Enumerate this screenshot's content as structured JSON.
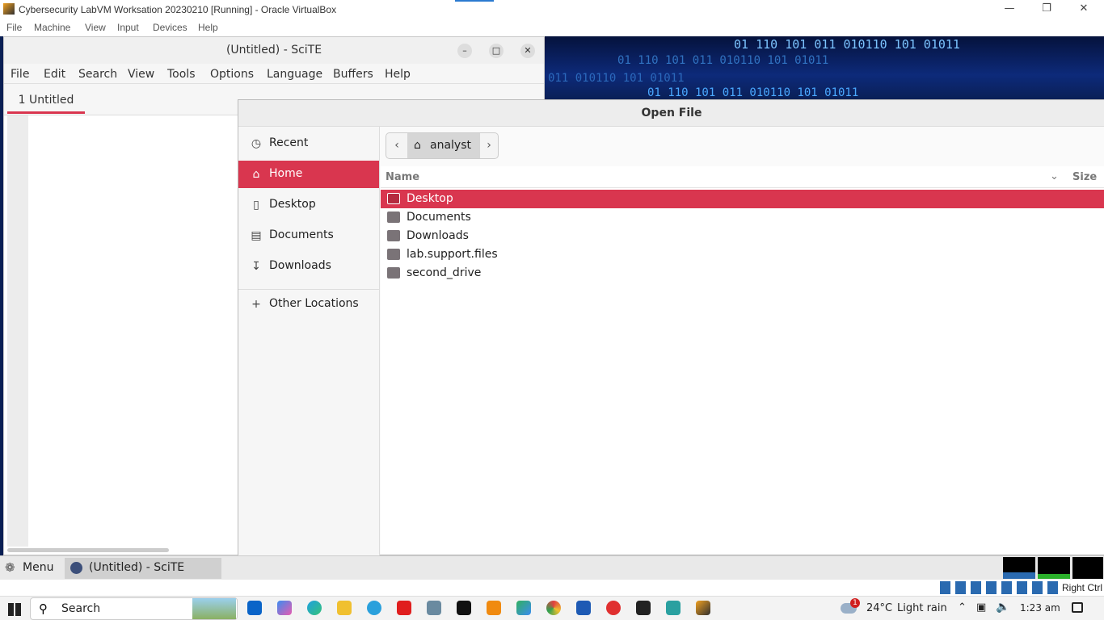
{
  "vbox": {
    "title": "Cybersecurity LabVM Worksation 20230210 [Running] - Oracle VirtualBox",
    "menu": [
      "File",
      "Machine",
      "View",
      "Input",
      "Devices",
      "Help"
    ]
  },
  "wallpaper": {
    "line1": "01 110 101 011 010110 101 01011",
    "line2": "01 110 101 011 010110 101 01011",
    "line3": "011 010110 101 01011",
    "line4": "01 110 101 011 010110 101 01011"
  },
  "scite": {
    "title": "(Untitled) - SciTE",
    "menu": [
      "File",
      "Edit",
      "Search",
      "View",
      "Tools",
      "Options",
      "Language",
      "Buffers",
      "Help"
    ],
    "tab": "1 Untitled"
  },
  "dialog": {
    "title": "Open File",
    "places": [
      {
        "label": "Recent",
        "icon": "clock-icon"
      },
      {
        "label": "Home",
        "icon": "home-icon",
        "selected": true
      },
      {
        "label": "Desktop",
        "icon": "desktop-icon"
      },
      {
        "label": "Documents",
        "icon": "document-icon"
      },
      {
        "label": "Downloads",
        "icon": "download-icon"
      },
      {
        "label": "Other Locations",
        "icon": "plus-icon"
      }
    ],
    "path": "analyst",
    "columns": {
      "name": "Name",
      "size": "Size"
    },
    "files": [
      "Desktop",
      "Documents",
      "Downloads",
      "lab.support.files",
      "second_drive"
    ],
    "selected_file": "Desktop"
  },
  "panel": {
    "menu": "Menu",
    "task": "(Untitled) - SciTE"
  },
  "host_tray": {
    "right_ctrl": "Right Ctrl"
  },
  "taskbar": {
    "search": "Search",
    "weather_temp": "24°C",
    "weather_text": "Light rain",
    "time": "1:23 am",
    "weather_badge": "1"
  },
  "colors": {
    "accent": "#d9364f",
    "wallpaper": "#0a1f54"
  }
}
